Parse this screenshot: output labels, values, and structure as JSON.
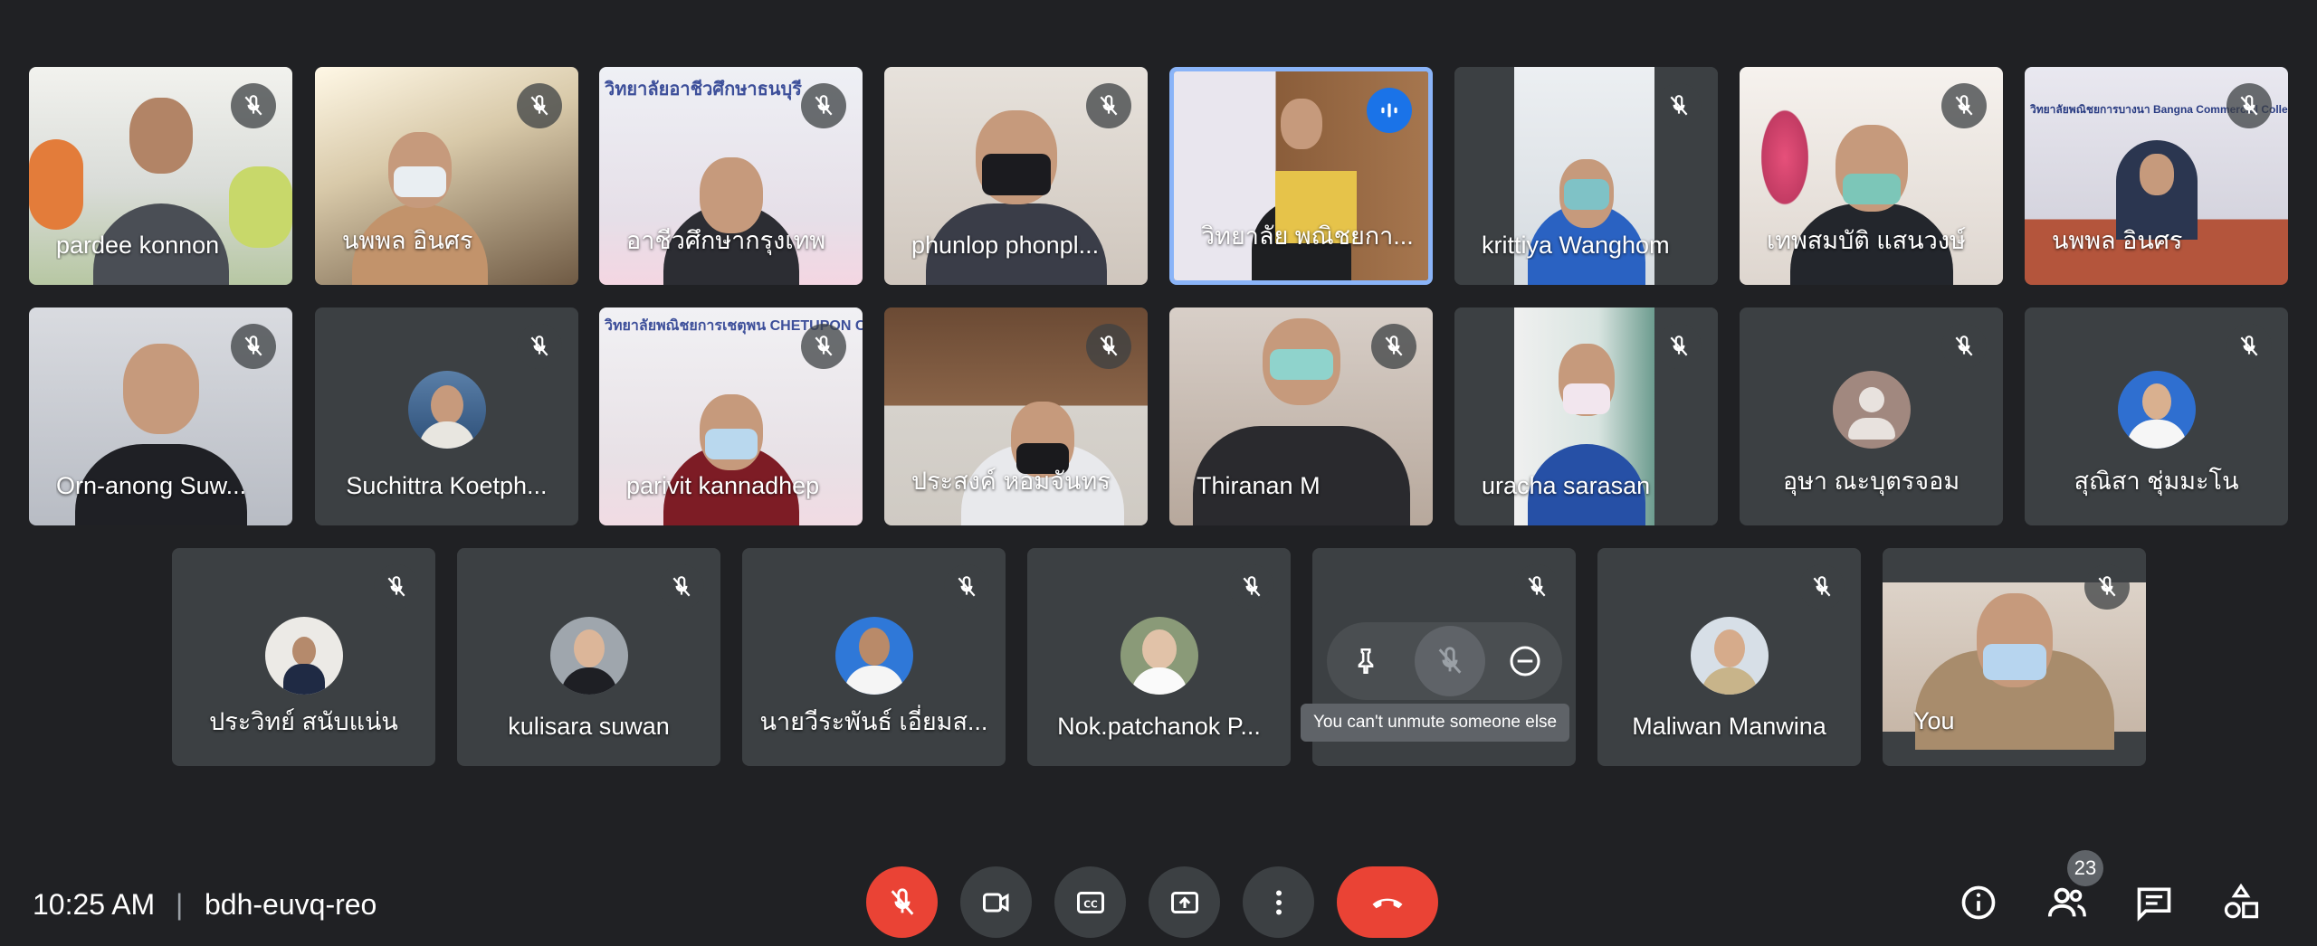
{
  "participants": [
    {
      "name": "pardee konnon",
      "state": "muted"
    },
    {
      "name": "นพพล อินศร",
      "state": "muted"
    },
    {
      "name": "อาชีวศึกษากรุงเทพ",
      "state": "muted",
      "sign": "วิทยาลัยอาชีวศึกษาธนบุรี"
    },
    {
      "name": "phunlop phonpl...",
      "state": "muted"
    },
    {
      "name": "วิทยาลัย พณิชยกา...",
      "state": "speaking"
    },
    {
      "name": "krittiya Wanghom",
      "state": "muted"
    },
    {
      "name": "เทพสมบัติ แสนวงษ์",
      "state": "muted"
    },
    {
      "name": "นพพล อินศร",
      "state": "muted",
      "sign": "วิทยาลัยพณิชยการบางนา Bangna Commercial College"
    },
    {
      "name": "Orn-anong Suw...",
      "state": "muted"
    },
    {
      "name": "Suchittra Koetph...",
      "state": "muted"
    },
    {
      "name": "parivit kannadhep",
      "state": "muted",
      "sign": "วิทยาลัยพณิชยการเชตุพน CHETUPON COMMERCIAL COLLEGE"
    },
    {
      "name": "ประสงค์ หอมจันทร",
      "state": "muted"
    },
    {
      "name": "Thiranan M",
      "state": "muted"
    },
    {
      "name": "uracha sarasan",
      "state": "muted"
    },
    {
      "name": "อุษา ณะบุตรจอม",
      "state": "muted"
    },
    {
      "name": "สุณิสา ชุ่มมะโน",
      "state": "muted"
    },
    {
      "name": "ประวิทย์ สนับแน่น",
      "state": "muted"
    },
    {
      "name": "kulisara suwan",
      "state": "muted"
    },
    {
      "name": "นายวีระพันธ์ เอี่ยมส...",
      "state": "muted"
    },
    {
      "name": "Nok.patchanok P...",
      "state": "muted"
    },
    {
      "name": "",
      "state": "hover"
    },
    {
      "name": "Maliwan Manwina",
      "state": "muted"
    },
    {
      "name": "You",
      "state": "muted"
    }
  ],
  "hover_tooltip": "You can't unmute someone else",
  "meeting": {
    "time": "10:25 AM",
    "separator": "|",
    "code": "bdh-euvq-reo"
  },
  "people_count": "23",
  "colors": {
    "background": "#202124",
    "tile": "#3c4043",
    "red": "#ea4335",
    "accent": "#8ab4f8"
  },
  "icons": [
    "mic-off-icon",
    "camera-icon",
    "captions-icon",
    "present-icon",
    "more-icon",
    "end-call-icon",
    "info-icon",
    "people-icon",
    "chat-icon",
    "activities-icon",
    "pin-icon",
    "remove-icon"
  ]
}
